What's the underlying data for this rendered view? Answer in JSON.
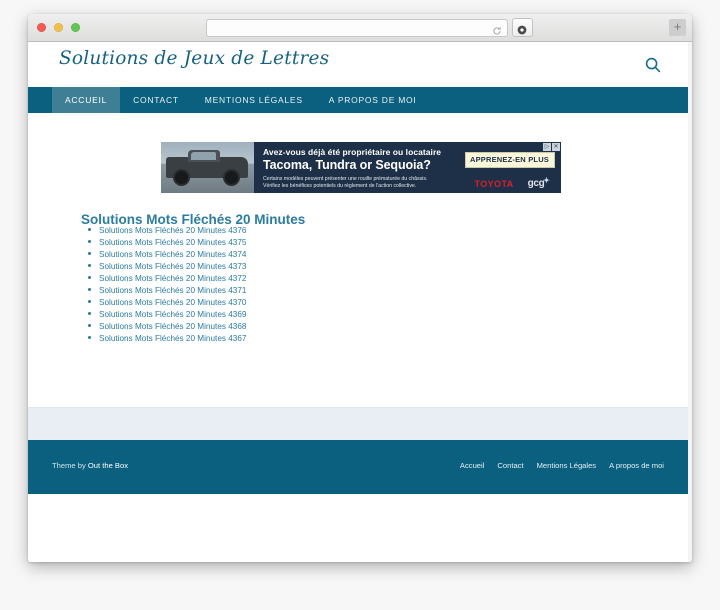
{
  "browser": {
    "url_value": "",
    "url_placeholder": "",
    "reload_icon": "reload-icon",
    "reader_icon": "reader-view-icon",
    "new_tab_label": "+",
    "traffic_lights": [
      "close",
      "minimize",
      "zoom"
    ]
  },
  "site": {
    "title": "Solutions de Jeux de Lettres",
    "search_icon": "search-icon"
  },
  "nav": {
    "items": [
      {
        "label": "ACCUEIL",
        "active": true
      },
      {
        "label": "CONTACT",
        "active": false
      },
      {
        "label": "MENTIONS LÉGALES",
        "active": false
      },
      {
        "label": "A PROPOS DE MOI",
        "active": false
      }
    ]
  },
  "ad": {
    "line1": "Avez-vous déjà été propriétaire ou locataire",
    "line2": "Tacoma, Tundra or Sequoia?",
    "fine_print_1": "Certains modèles peuvent présenter une rouille prématurée du châssis.",
    "fine_print_2": "Vérifiez les bénéfices potentiels du règlement de l'action collective.",
    "cta_label": "APPRENEZ-EN PLUS",
    "brand_primary": "TOYOTA",
    "brand_secondary": "gcg",
    "adchoices_label": "▷",
    "close_label": "✕"
  },
  "main": {
    "page_title": "Solutions Mots Fléchés 20 Minutes",
    "posts": [
      {
        "label": "Solutions Mots Fléchés 20 Minutes 4376"
      },
      {
        "label": "Solutions Mots Fléchés 20 Minutes 4375"
      },
      {
        "label": "Solutions Mots Fléchés 20 Minutes 4374"
      },
      {
        "label": "Solutions Mots Fléchés 20 Minutes 4373"
      },
      {
        "label": "Solutions Mots Fléchés 20 Minutes 4372"
      },
      {
        "label": "Solutions Mots Fléchés 20 Minutes 4371"
      },
      {
        "label": "Solutions Mots Fléchés 20 Minutes 4370"
      },
      {
        "label": "Solutions Mots Fléchés 20 Minutes 4369"
      },
      {
        "label": "Solutions Mots Fléchés 20 Minutes 4368"
      },
      {
        "label": "Solutions Mots Fléchés 20 Minutes 4367"
      }
    ]
  },
  "footer": {
    "credit_prefix": "Theme by",
    "credit_link": "Out the Box",
    "links": [
      {
        "label": "Accueil"
      },
      {
        "label": "Contact"
      },
      {
        "label": "Mentions Légales"
      },
      {
        "label": "A propos de moi"
      }
    ]
  },
  "colors": {
    "brand_teal": "#0c607f",
    "nav_active": "#3e7f95",
    "link_teal": "#2b7ca0",
    "title_teal": "#17627f",
    "widget_band": "#e8eef4",
    "ad_navy": "#1d3047",
    "ad_cta": "#faf6dc",
    "toyota_red": "#d8202f"
  }
}
